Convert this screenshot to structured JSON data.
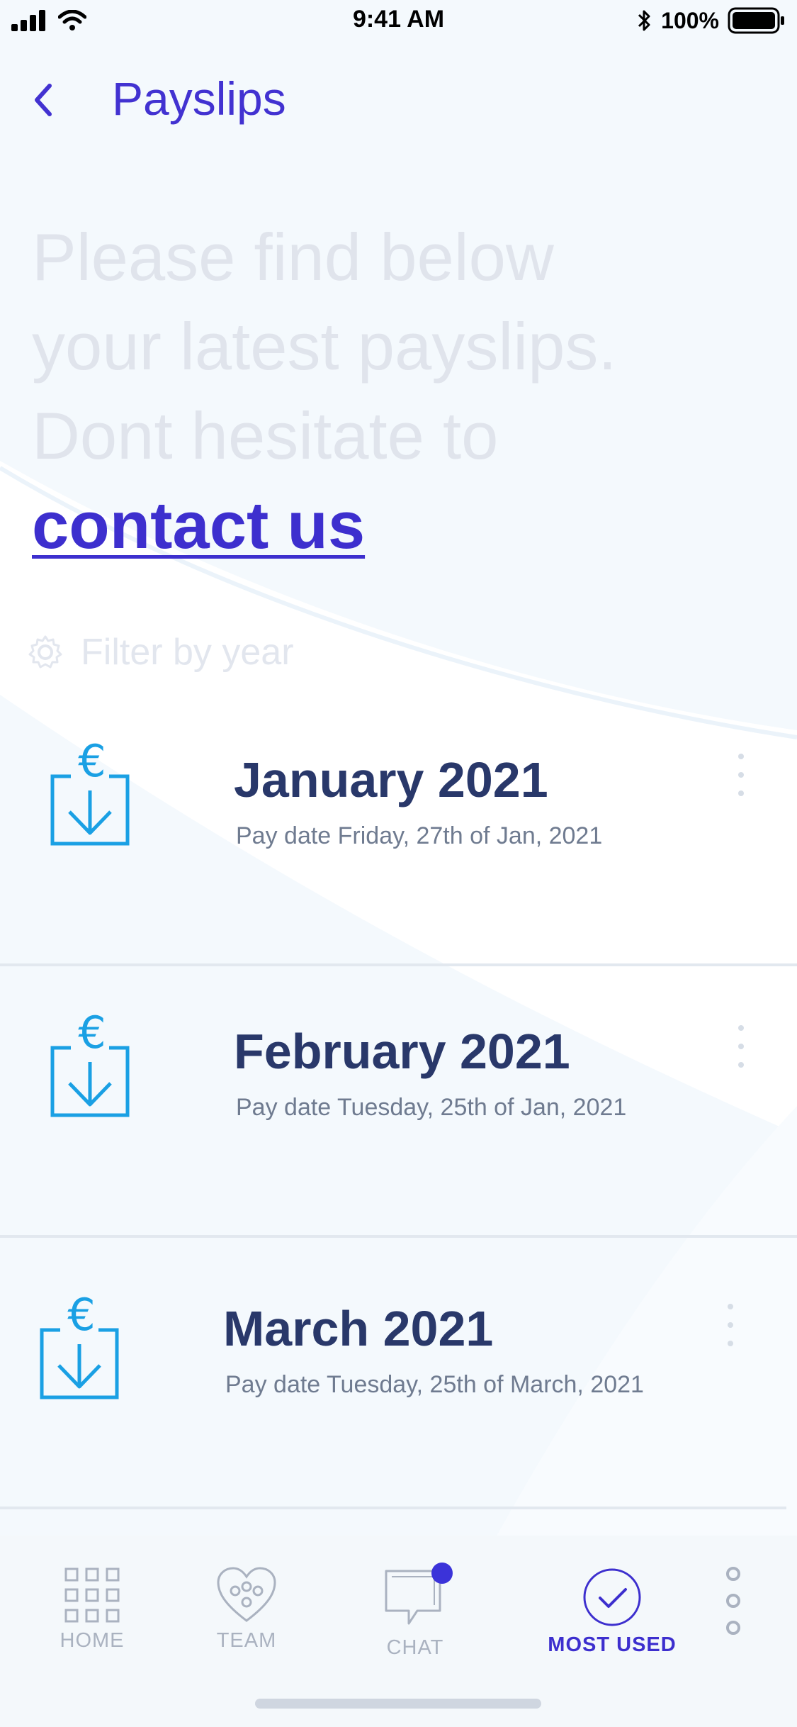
{
  "status_bar": {
    "time": "9:41 AM",
    "battery": "100%",
    "icons": [
      "signal-icon",
      "wifi-icon",
      "bluetooth-icon",
      "battery-icon"
    ]
  },
  "header": {
    "title": "Payslips",
    "back_icon": "chevron-left-icon"
  },
  "intro": {
    "line1": "Please find below",
    "line2": "your latest payslips.",
    "line3": "Dont hesitate to",
    "link": "contact us"
  },
  "filter": {
    "label": "Filter by year",
    "icon": "gear-icon"
  },
  "payslips": [
    {
      "month": "January 2021",
      "pay_date": "Pay date Friday, 27th of Jan, 2021",
      "icon": "euro-download-icon"
    },
    {
      "month": "February 2021",
      "pay_date": "Pay date Tuesday, 25th of Jan, 2021",
      "icon": "euro-download-icon"
    },
    {
      "month": "March 2021",
      "pay_date": "Pay date Tuesday, 25th of March, 2021",
      "icon": "euro-download-icon"
    }
  ],
  "tabbar": {
    "tabs": [
      {
        "label": "HOME",
        "icon": "grid-icon",
        "active": false
      },
      {
        "label": "TEAM",
        "icon": "heart-people-icon",
        "active": false
      },
      {
        "label": "CHAT",
        "icon": "chat-bubble-icon",
        "active": false
      },
      {
        "label": "MOST USED",
        "icon": "check-circle-icon",
        "active": true
      }
    ],
    "more_icon": "vertical-dots-icon"
  },
  "colors": {
    "accent": "#3d2fce",
    "icon_blue": "#1aa0e4",
    "title_navy": "#29386a",
    "muted_text": "#6f7b90",
    "faded_text": "#e0e4ec",
    "background": "#f4f9fd"
  }
}
